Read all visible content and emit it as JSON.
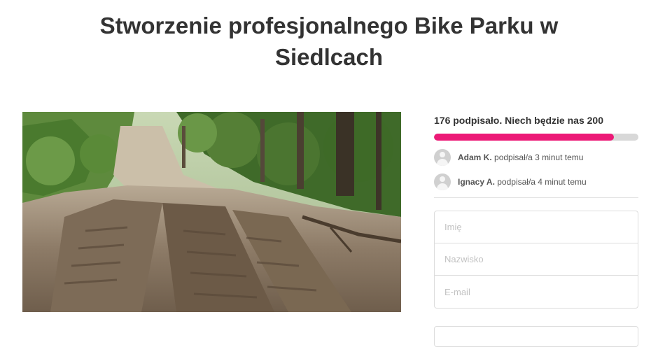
{
  "petition": {
    "title": "Stworzenie profesjonalnego Bike Parku w Siedlcach"
  },
  "progress": {
    "text": "176 podpisało. Niech będzie nas 200",
    "signed": 176,
    "goal": 200,
    "fraction": 0.88,
    "fill_color": "#ec1a77",
    "track_color": "#d8d8d8"
  },
  "recent_signers": [
    {
      "name": "Adam K.",
      "action": "podpisał/a 3 minut temu",
      "icon": "user-avatar-icon"
    },
    {
      "name": "Ignacy A.",
      "action": "podpisał/a 4 minut temu",
      "icon": "user-avatar-icon"
    }
  ],
  "form": {
    "first_name_placeholder": "Imię",
    "last_name_placeholder": "Nazwisko",
    "email_placeholder": "E-mail"
  }
}
